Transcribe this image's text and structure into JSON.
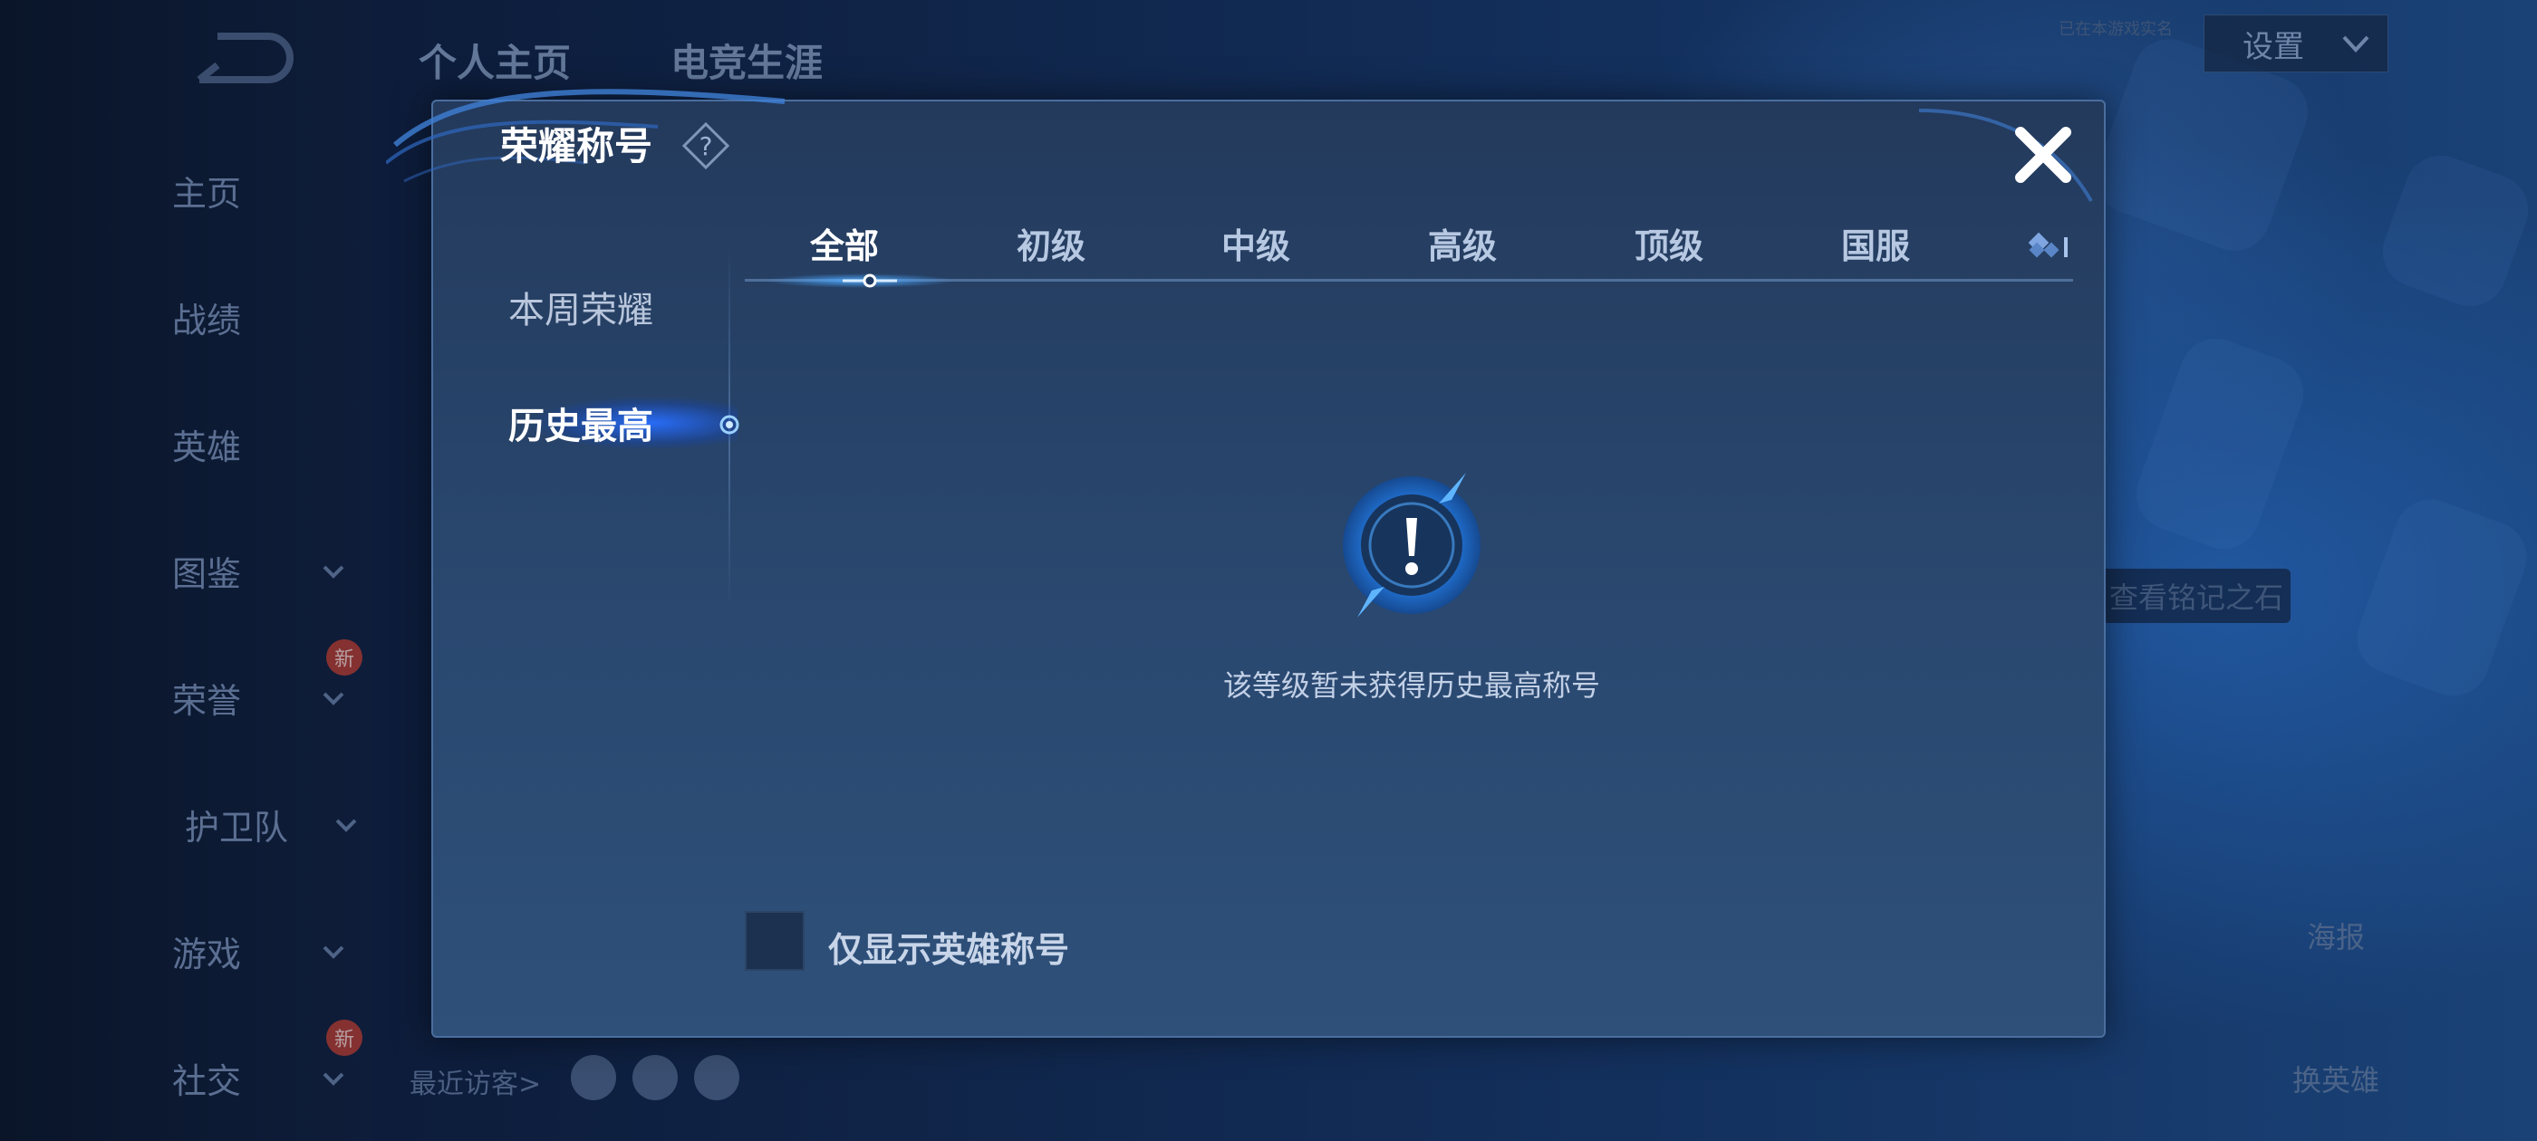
{
  "background": {
    "top_tabs": [
      "个人主页",
      "电竞生涯"
    ],
    "settings_label": "设置",
    "tiny_note": "已在本游戏实名",
    "nav_items": [
      {
        "label": "主页",
        "has_chevron": false,
        "badge": ""
      },
      {
        "label": "战绩",
        "has_chevron": false,
        "badge": ""
      },
      {
        "label": "英雄",
        "has_chevron": false,
        "badge": ""
      },
      {
        "label": "图鉴",
        "has_chevron": true,
        "badge": ""
      },
      {
        "label": "荣誉",
        "has_chevron": true,
        "badge": "新"
      },
      {
        "label": "护卫队",
        "has_chevron": true,
        "badge": ""
      },
      {
        "label": "游戏",
        "has_chevron": true,
        "badge": ""
      },
      {
        "label": "社交",
        "has_chevron": true,
        "badge": "新"
      }
    ],
    "recent_visitors_label": "最近访客>",
    "right_chip_label": "查看铭记之石",
    "poster_label": "海报",
    "change_hero_label": "换英雄"
  },
  "modal": {
    "title": "荣耀称号",
    "help_icon": "question-diamond-icon",
    "close_icon": "close-x-icon",
    "side_menu": [
      {
        "label": "本周荣耀",
        "active": false
      },
      {
        "label": "历史最高",
        "active": true
      }
    ],
    "tabs": [
      {
        "label": "全部",
        "active": true
      },
      {
        "label": "初级",
        "active": false
      },
      {
        "label": "中级",
        "active": false
      },
      {
        "label": "高级",
        "active": false
      },
      {
        "label": "顶级",
        "active": false
      },
      {
        "label": "国服",
        "active": false
      }
    ],
    "empty_state": {
      "icon": "exclamation-circle-icon",
      "message": "该等级暂未获得历史最高称号"
    },
    "filter": {
      "label": "仅显示英雄称号",
      "checked": false
    }
  },
  "colors": {
    "accent": "#2f8cff",
    "modal_bg": "#2a4870",
    "text_primary": "#ffffff",
    "text_secondary": "#b7c8e2"
  }
}
